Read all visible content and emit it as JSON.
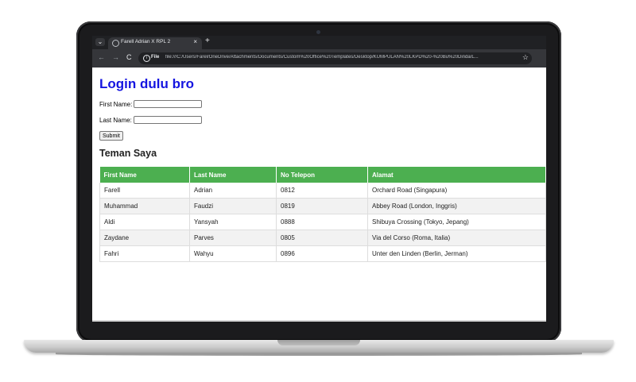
{
  "browser": {
    "tab_title": "Farell Adrian X RPL 2",
    "tab_close": "×",
    "new_tab": "+",
    "tab_menu": "⌄",
    "nav": {
      "back": "←",
      "forward": "→",
      "reload": "C"
    },
    "file_chip": "File",
    "url": "file:///C:/Users/Farel/OneDrive/Attachments/Documents/Custom%20Office%20Templates/Desktop/KUMPULAN%20LKPD%20-%20Bu%20Dinda/L...",
    "star": "☆"
  },
  "page": {
    "title": "Login dulu bro",
    "form": {
      "first_name_label": "First Name:",
      "last_name_label": "Last Name:",
      "first_name_value": "",
      "last_name_value": "",
      "submit_label": "Submit"
    },
    "section_title": "Teman Saya",
    "table": {
      "headers": [
        "First Name",
        "Last Name",
        "No Telepon",
        "Alamat"
      ],
      "rows": [
        [
          "Farell",
          "Adrian",
          "0812",
          "Orchard Road (Singapura)"
        ],
        [
          "Muhammad",
          "Faudzi",
          "0819",
          "Abbey Road (London, Inggris)"
        ],
        [
          "Aldi",
          "Yansyah",
          "0888",
          "Shibuya Crossing (Tokyo, Jepang)"
        ],
        [
          "Zaydane",
          "Parves",
          "0805",
          "Via del Corso (Roma, Italia)"
        ],
        [
          "Fahri",
          "Wahyu",
          "0896",
          "Unter den Linden (Berlin, Jerman)"
        ]
      ]
    }
  },
  "colors": {
    "title": "#1515e0",
    "table_header": "#4caf50",
    "browser_dark": "#202124"
  }
}
